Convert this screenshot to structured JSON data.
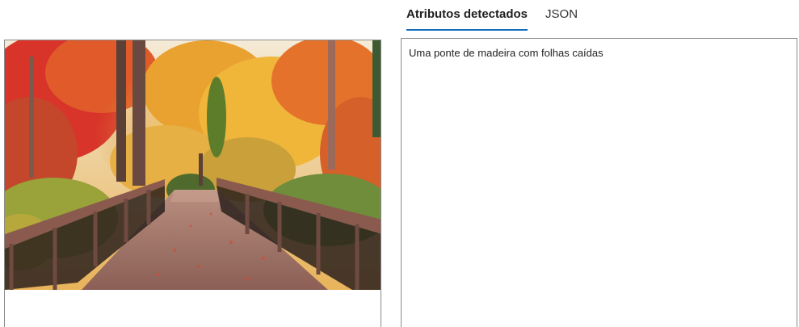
{
  "tabs": [
    {
      "label": "Atributos detectados",
      "active": true
    },
    {
      "label": "JSON",
      "active": false
    }
  ],
  "result": {
    "caption": "Uma ponte de madeira com folhas caídas"
  },
  "image": {
    "subject": "wooden-bridge-autumn-forest-photo"
  },
  "colors": {
    "accent": "#0f6cbd",
    "border": "#8a8a8a"
  }
}
